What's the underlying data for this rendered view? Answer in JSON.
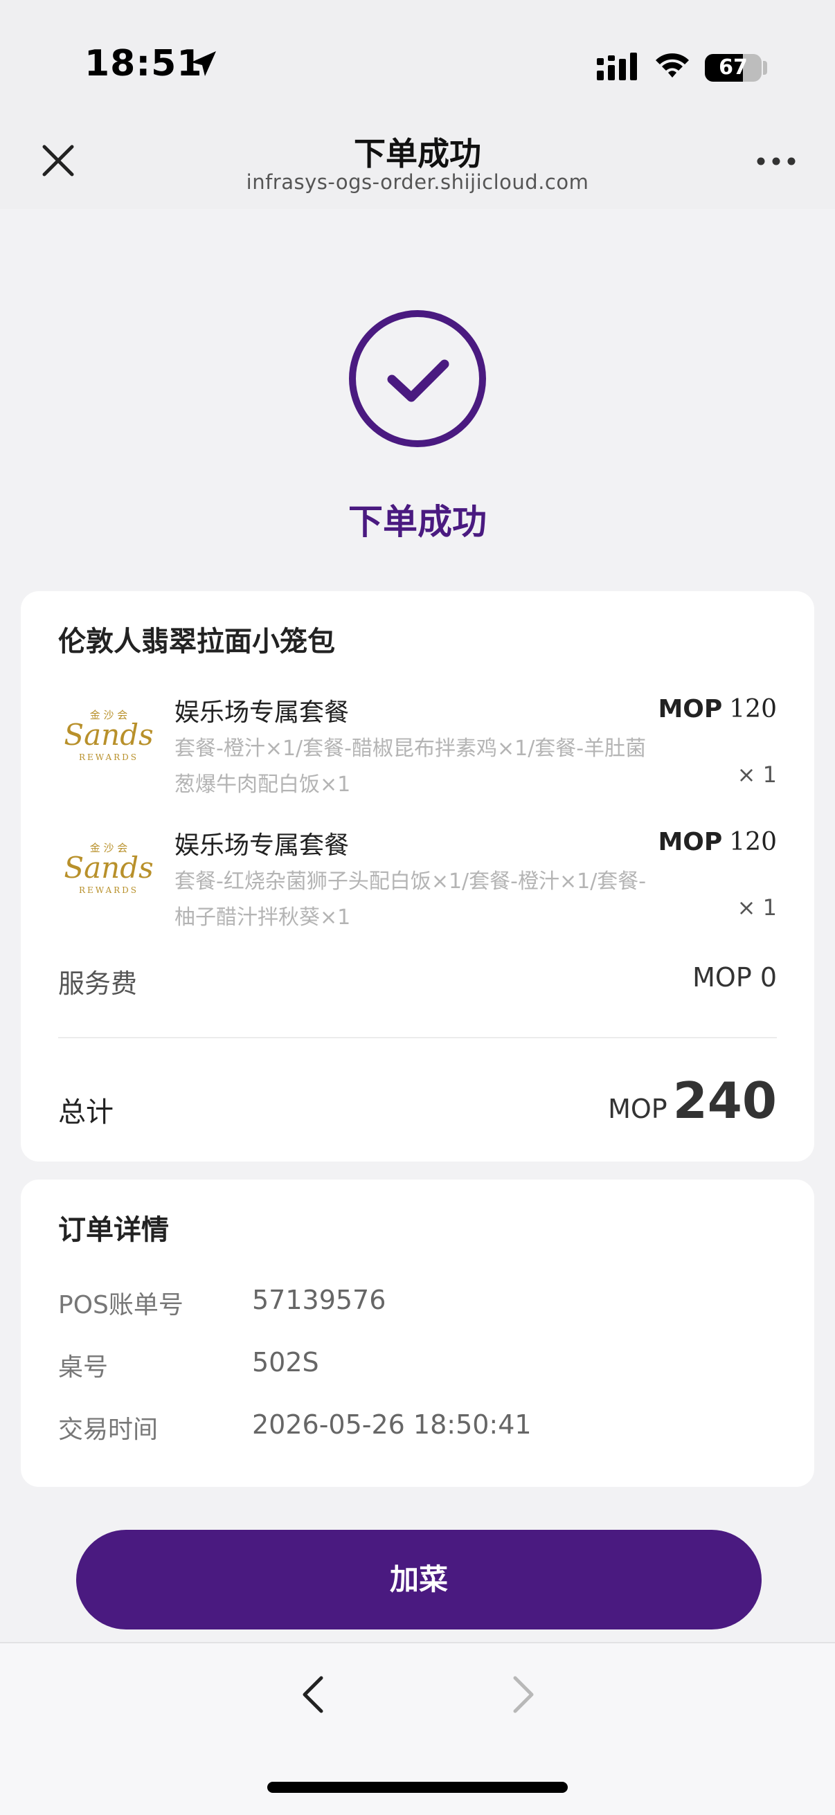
{
  "status": {
    "time": "18:51",
    "battery": "67",
    "battery_level": 0.67
  },
  "header": {
    "title": "下单成功",
    "subtitle": "infrasys-ogs-order.shijicloud.com"
  },
  "success": {
    "text": "下单成功"
  },
  "order": {
    "restaurant": "伦敦人翡翠拉面小笼包",
    "items": [
      {
        "name": "娱乐场专属套餐",
        "desc": "套餐-橙汁×1/套餐-醋椒昆布拌素鸡×1/套餐-羊肚菌葱爆牛肉配白饭×1",
        "currency": "MOP",
        "amount": "120",
        "qty": "× 1"
      },
      {
        "name": "娱乐场专属套餐",
        "desc": "套餐-红烧杂菌狮子头配白饭×1/套餐-橙汁×1/套餐-柚子醋汁拌秋葵×1",
        "currency": "MOP",
        "amount": "120",
        "qty": "× 1"
      }
    ],
    "logo": {
      "top": "金 沙 会",
      "main": "Sands",
      "sub": "REWARDS"
    },
    "service_fee_label": "服务费",
    "service_fee_value": "MOP 0",
    "total_label": "总计",
    "total_currency": "MOP",
    "total_amount": "240"
  },
  "details": {
    "title": "订单详情",
    "rows": [
      {
        "label": "POS账单号",
        "value": "57139576"
      },
      {
        "label": "桌号",
        "value": "502S"
      },
      {
        "label": "交易时间",
        "value": "2026-05-26 18:50:41"
      }
    ]
  },
  "actions": {
    "add_label": "加菜"
  },
  "colors": {
    "accent": "#4a1a80",
    "gold": "#b8902a"
  },
  "icons": [
    "location-arrow-icon",
    "signal-icon",
    "wifi-icon",
    "close-icon",
    "more-icon",
    "check-circle-icon",
    "chevron-left-icon",
    "chevron-right-icon"
  ]
}
